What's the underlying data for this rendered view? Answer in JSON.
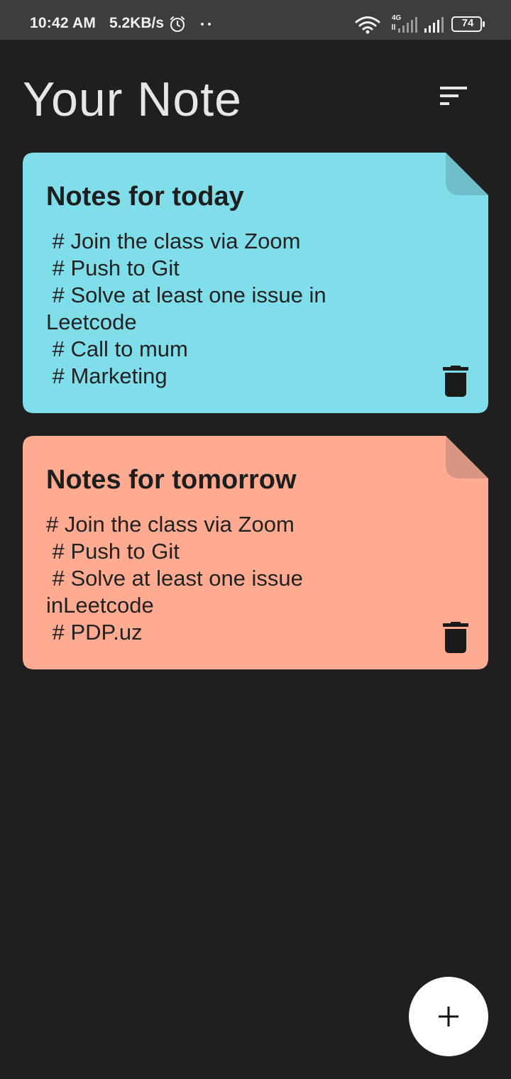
{
  "status_bar": {
    "time": "10:42 AM",
    "net_speed": "5.2KB/s",
    "network_type": "4G",
    "battery": "74",
    "icons": [
      "alarm-icon",
      "dots-icon",
      "wifi-icon",
      "signal-4g-icon",
      "signal-icon",
      "battery-icon"
    ]
  },
  "header": {
    "title": "Your Note",
    "sort_icon": "sort-icon"
  },
  "notes": [
    {
      "title": "Notes for today",
      "body": " # Join the class via Zoom\n # Push to Git\n # Solve at least one issue in Leetcode\n # Call to mum\n # Marketing",
      "color": "#80deea",
      "fold_color": "#6fbfca",
      "delete_icon": "trash-icon"
    },
    {
      "title": "Notes for tomorrow",
      "body": "# Join the class via Zoom\n # Push to Git\n # Solve at least one issue inLeetcode\n # PDP.uz",
      "color": "#ffab91",
      "fold_color": "#d99583",
      "delete_icon": "trash-icon"
    }
  ],
  "fab": {
    "icon": "plus-icon"
  },
  "colors": {
    "background": "#1f1f1f",
    "status_bar": "#3d3d3d",
    "title_text": "#e6e6e6"
  }
}
